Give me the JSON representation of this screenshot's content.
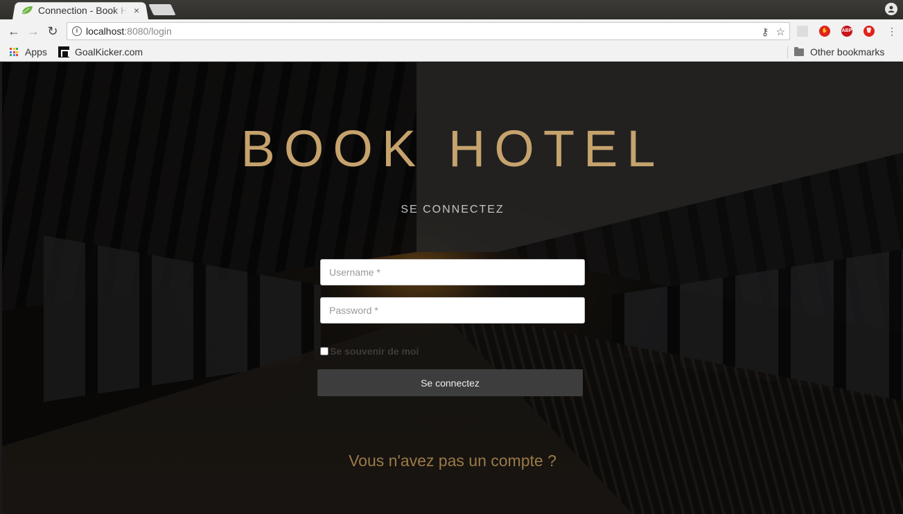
{
  "browser": {
    "tab_title": "Connection - Book Hotel",
    "tab_close": "×",
    "url_host": "localhost",
    "url_rest": ":8080/login",
    "bookmarks": {
      "apps": "Apps",
      "goalkicker": "GoalKicker.com",
      "other": "Other bookmarks"
    },
    "extensions": {
      "abp": "ABP"
    }
  },
  "login": {
    "title": "BOOK HOTEL",
    "subtitle": "SE CONNECTEZ",
    "username_placeholder": "Username *",
    "password_placeholder": "Password *",
    "remember_label": "Se souvenir de moi",
    "submit_label": "Se connectez",
    "signup_link": "Vous n'avez pas un compte ?"
  },
  "colors": {
    "title": "#c6a26d",
    "signup_link": "#9b7a48",
    "submit_bg": "#3d3d3d"
  }
}
